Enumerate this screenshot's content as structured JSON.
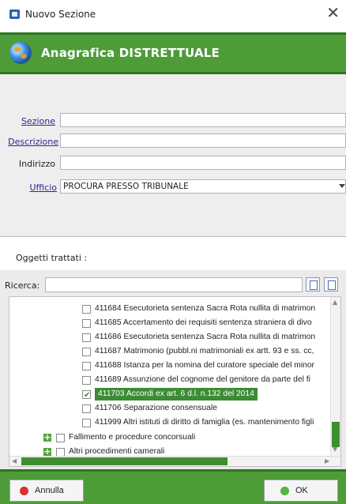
{
  "window": {
    "title": "Nuovo Sezione",
    "close_glyph": "✕"
  },
  "header": {
    "title": "Anagrafica DISTRETTUALE",
    "icon": "globe-icon"
  },
  "form": {
    "sezione_label": "Sezione",
    "descrizione_label": "Descrizione",
    "indirizzo_label": "Indirizzo",
    "ufficio_label": "Ufficio",
    "ufficio_value": "PROCURA PRESSO TRIBUNALE",
    "sezione_value": "",
    "descrizione_value": "",
    "indirizzo_value": ""
  },
  "oggetti": {
    "label": "Oggetti trattati :",
    "search_label": "Ricerca:",
    "search_value": ""
  },
  "tree": {
    "items": [
      {
        "text": "411684 Esecutorieta sentenza Sacra Rota nullita di matrimon",
        "checked": false
      },
      {
        "text": "411685 Accertamento dei requisiti sentenza straniera di divo",
        "checked": false
      },
      {
        "text": "411686 Esecutorieta sentenza Sacra Rota nullita di matrimon",
        "checked": false
      },
      {
        "text": "411687 Matrimonio (pubbl.ni matrimoniali ex artt. 93 e ss. cc,",
        "checked": false
      },
      {
        "text": "411688 Istanza per la nomina del curatore speciale del minor",
        "checked": false
      },
      {
        "text": "411689 Assunzione del cognome del genitore da parte del fi",
        "checked": false
      },
      {
        "text": "411703 Accordi ex art. 6 d.l. n.132 del 2014",
        "checked": true
      },
      {
        "text": "411706 Separazione consensuale",
        "checked": false
      },
      {
        "text": "411999 Altri istituti di diritto di famiglia (es. mantenimento figli",
        "checked": false
      }
    ],
    "groups": [
      {
        "text": "Fallimento e procedure concorsuali"
      },
      {
        "text": "Altri procedimenti camerali"
      }
    ]
  },
  "footer": {
    "cancel_label": "Annulla",
    "ok_label": "OK"
  },
  "colors": {
    "accent_green": "#4e9c38",
    "accent_dark": "#2f7520"
  }
}
